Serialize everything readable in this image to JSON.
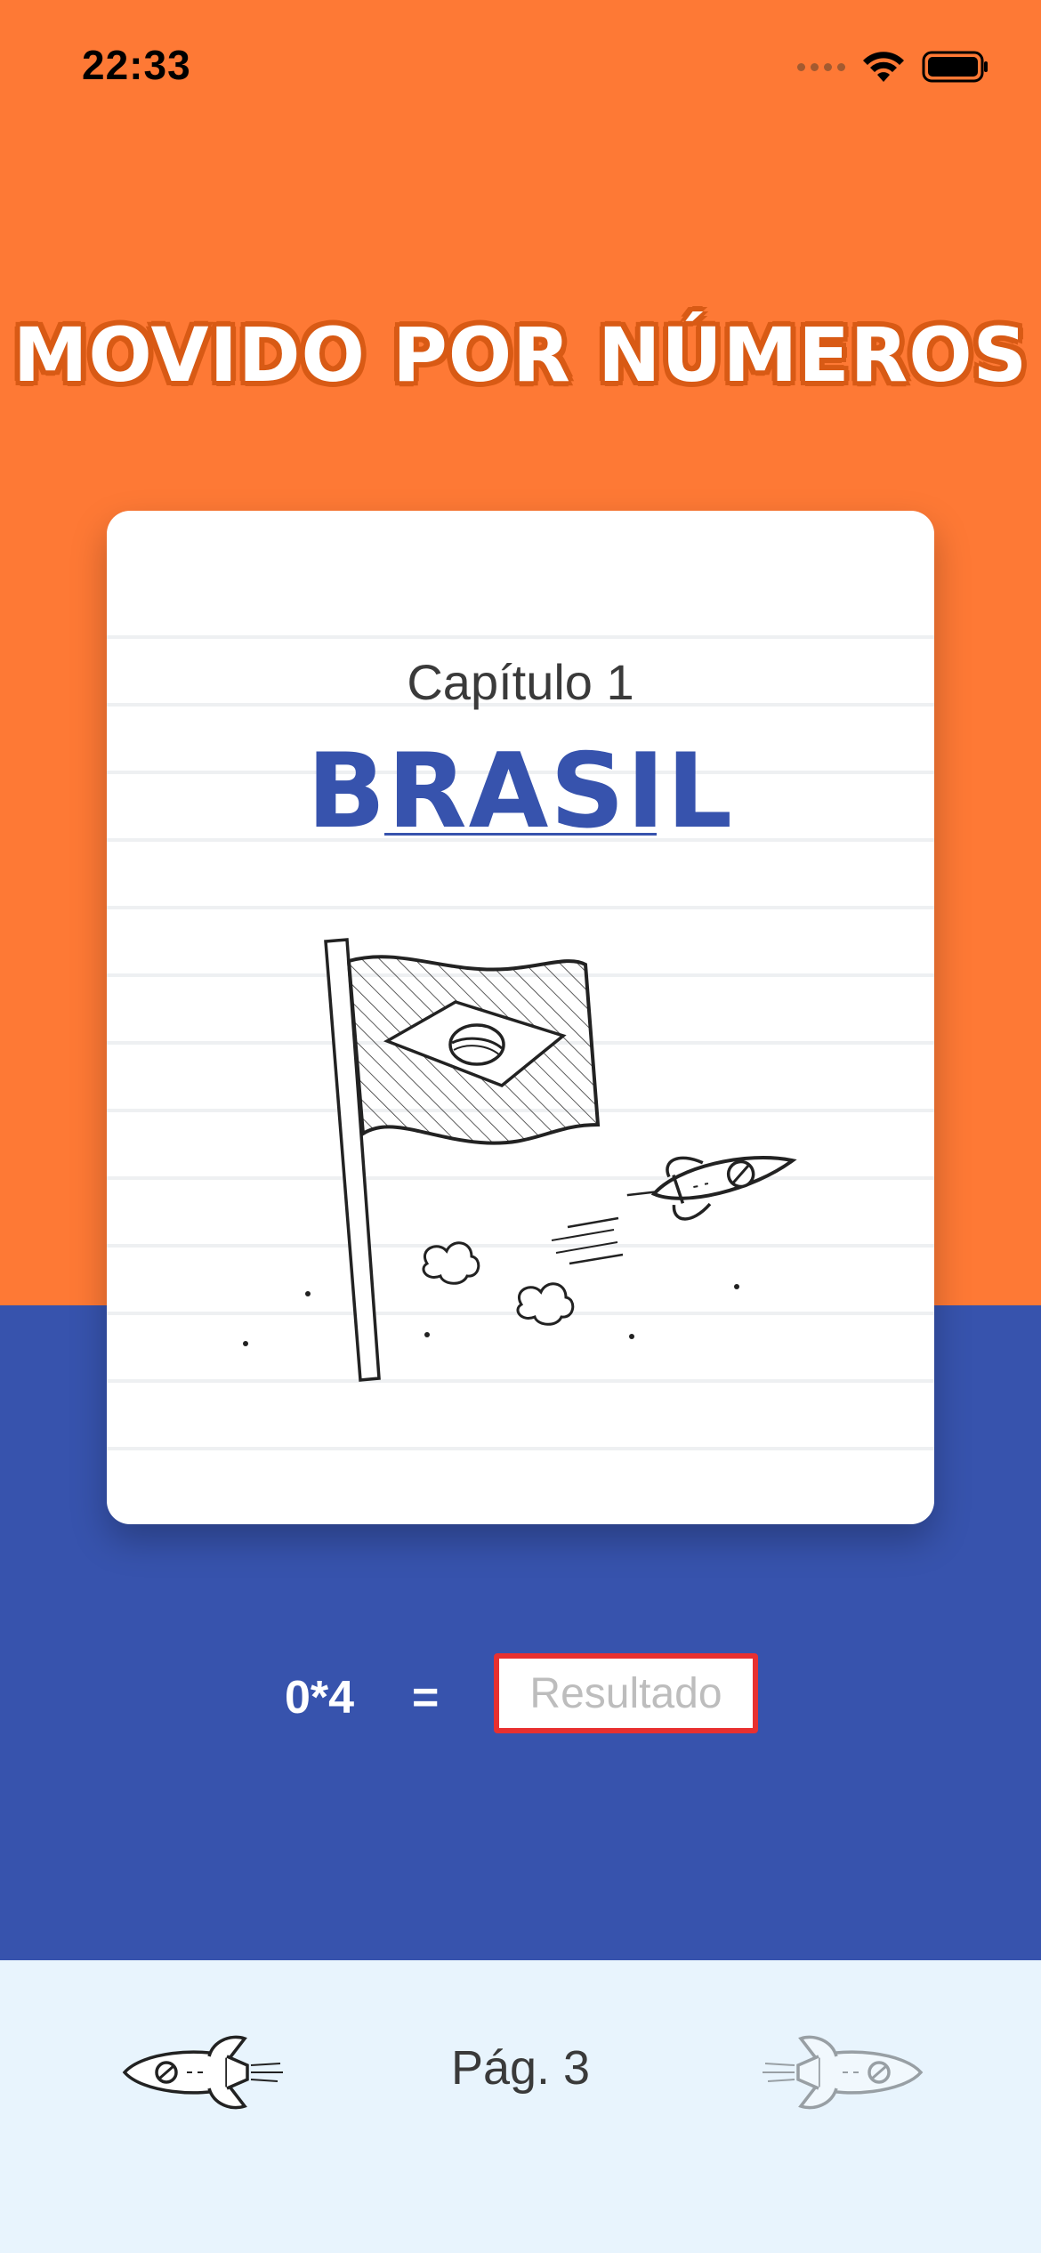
{
  "status_bar": {
    "time": "22:33",
    "wifi_icon": "wifi-icon",
    "battery_icon": "battery-icon"
  },
  "app": {
    "title": "MOVIDO POR NÚMEROS"
  },
  "card": {
    "chapter": "Capítulo 1",
    "country": "BRASIL",
    "illustration_icon": "flag-and-rocket-illustration"
  },
  "equation": {
    "operand": "0*4",
    "equals": "=",
    "result_placeholder": "Resultado",
    "result_value": ""
  },
  "footer": {
    "page_label": "Pág. 3",
    "prev_icon": "rocket-left-icon",
    "next_icon": "rocket-right-icon"
  },
  "colors": {
    "orange": "#FE7935",
    "blue": "#3753AD",
    "footer_bg": "#E8F4FD",
    "input_border": "#E83030"
  }
}
